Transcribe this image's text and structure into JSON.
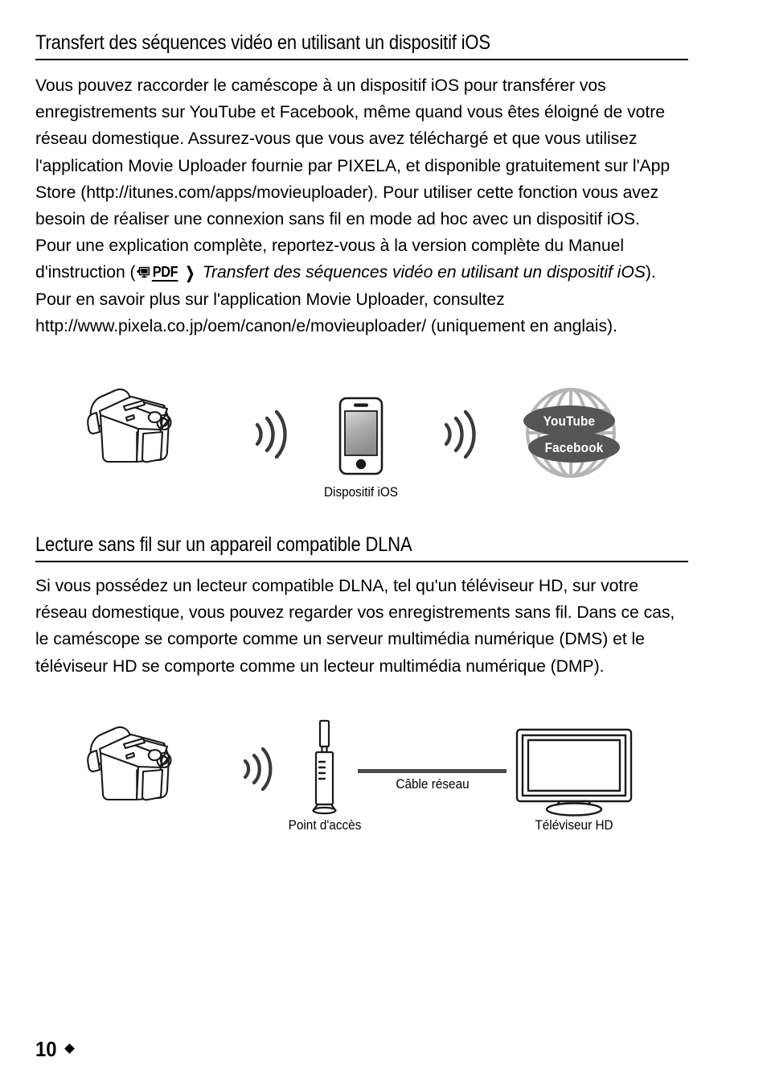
{
  "document": {
    "page_number": "10",
    "page_marker": "diamond-bullet"
  },
  "sections": [
    {
      "heading": "Transfert des séquences vidéo en utilisant un dispositif iOS",
      "paragraph_part1": "Vous pouvez raccorder le caméscope à un dispositif iOS pour transférer vos enregistrements sur YouTube et Facebook, même quand vous êtes éloigné de votre réseau domestique. Assurez-vous que vous avez téléchargé et que vous utilisez l'application Movie Uploader fournie par PIXELA, et disponible gratuitement sur l'App Store (http://itunes.com/apps/movieuploader). Pour utiliser cette fonction vous avez besoin de réaliser une connexion sans fil en mode ad hoc avec un dispositif iOS. Pour une explication complète, reportez-vous à la version complète du Manuel d'instruction (",
      "pdf_badge_label": "PDF",
      "pdf_badge_arrow": "❯",
      "paragraph_italic": "Transfert des séquences vidéo en utilisant un dispositif iOS",
      "paragraph_part2": "). Pour en savoir plus sur l'application Movie Uploader, consultez http://www.pixela.co.jp/oem/canon/e/movieuploader/ (uniquement en anglais)."
    },
    {
      "heading": "Lecture sans fil sur un appareil compatible DLNA",
      "paragraph": "Si vous possédez un lecteur compatible DLNA, tel qu'un téléviseur HD, sur votre réseau domestique, vous pouvez regarder vos enregistrements sans fil. Dans ce cas, le caméscope se comporte comme un serveur multimédia numérique (DMS) et le téléviseur HD se comporte comme un lecteur multimédia numérique (DMP)."
    }
  ],
  "figure_ios": {
    "device_caption": "Dispositif iOS",
    "globe_badges": [
      "YouTube",
      "Facebook"
    ],
    "globe_color": "#b5b5b5",
    "badge_color": "#555555",
    "wave_color": "#3a3a3a"
  },
  "figure_dlna": {
    "access_point_caption": "Point d'accès",
    "cable_caption": "Câble réseau",
    "tv_caption": "Téléviseur HD",
    "wave_color": "#3a3a3a",
    "cable_color": "#4a4a4a"
  }
}
